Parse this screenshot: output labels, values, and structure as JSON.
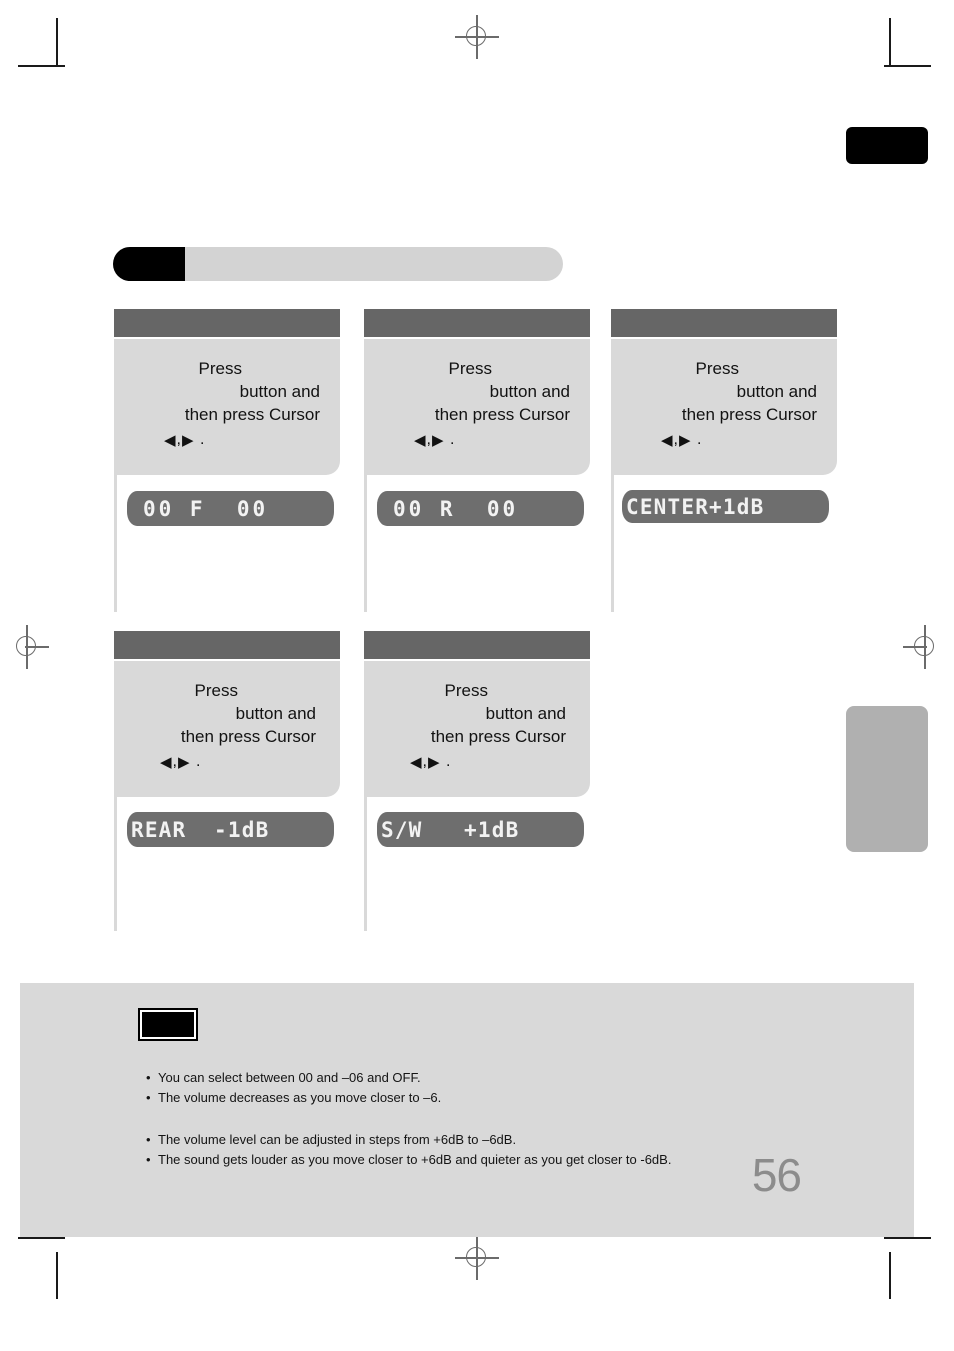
{
  "page": {
    "number": "56",
    "section_label": ""
  },
  "chapter_tab": {
    "label": ""
  },
  "side_tab": {
    "label": ""
  },
  "cards": [
    {
      "id": "front-speaker",
      "header_label": "",
      "line1": "Press",
      "line2": "button and",
      "line3": "then press Cursor",
      "cursor_left": "◀",
      "cursor_sep": ",",
      "cursor_right": "▶",
      "cursor_end": ".",
      "lcd": "00 F  00"
    },
    {
      "id": "rear-speaker",
      "header_label": "",
      "line1": "Press",
      "line2": "button and",
      "line3": "then press Cursor",
      "cursor_left": "◀",
      "cursor_sep": ",",
      "cursor_right": "▶",
      "cursor_end": ".",
      "lcd": "00 R  00"
    },
    {
      "id": "center-speaker",
      "header_label": "",
      "line1": "Press",
      "line2": "button and",
      "line3": "then press Cursor",
      "cursor_left": "◀",
      "cursor_sep": ",",
      "cursor_right": "▶",
      "cursor_end": ".",
      "lcd": "CENTER+1dB"
    },
    {
      "id": "rear-level",
      "header_label": "",
      "line1": "Press",
      "line2": "button and",
      "line3": "then press Cursor",
      "cursor_left": "◀",
      "cursor_sep": ",",
      "cursor_right": "▶",
      "cursor_end": ".",
      "lcd": "REAR  -1dB"
    },
    {
      "id": "subwoofer-level",
      "header_label": "",
      "line1": "Press",
      "line2": "button and",
      "line3": "then press Cursor",
      "cursor_left": "◀",
      "cursor_sep": ",",
      "cursor_right": "▶",
      "cursor_end": ".",
      "lcd": "S/W   +1dB"
    }
  ],
  "notes": {
    "badge_label": "",
    "group_a": [
      "You can select between 00 and –06 and OFF.",
      "The volume decreases as you move closer to –6."
    ],
    "group_b": [
      "The volume level can be adjusted in steps from +6dB to –6dB.",
      "The sound gets louder as you move closer to +6dB and quieter as you get closer to -6dB."
    ]
  },
  "colors": {
    "card_header": "#666666",
    "card_body": "#d9d9d9",
    "lcd_background": "#6e6e6e",
    "lcd_text": "#f2f2f2",
    "notes_panel": "#d9d9d9",
    "page_number": "#8c8c8c",
    "side_tab": "#b0b0b0",
    "chapter_tab": "#000000"
  }
}
